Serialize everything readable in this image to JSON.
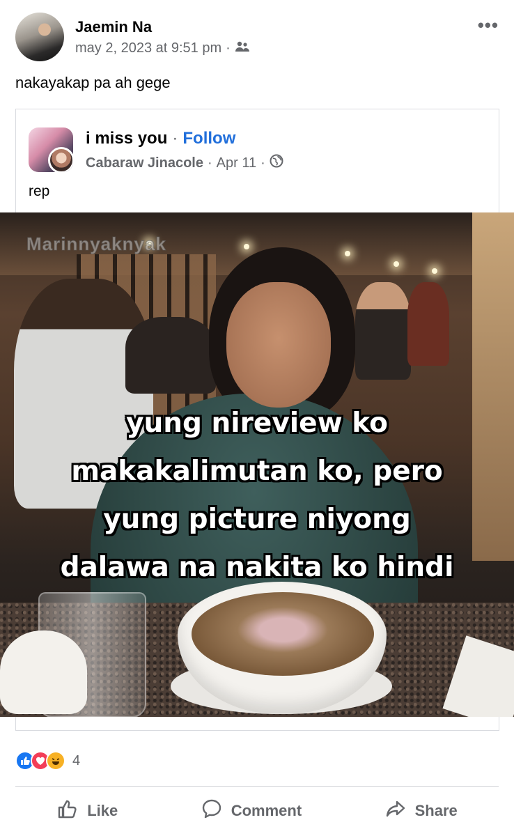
{
  "post": {
    "author": "Jaemin Na",
    "timestamp": "may 2, 2023 at 9:51 pm",
    "separator": "·",
    "audience_icon": "friends-icon",
    "more_label": "•••",
    "caption": "nakayakap pa ah gege"
  },
  "shared": {
    "group_name": "i miss you",
    "separator": "·",
    "follow_label": "Follow",
    "author": "Cabaraw Jinacole",
    "date": "Apr 11",
    "audience_icon": "globe-icon",
    "caption": "rep",
    "image": {
      "watermark": "Marinnyaknyak",
      "meme_lines": [
        "yung nireview ko",
        "makakalimutan ko, pero",
        "yung picture niyong",
        "dalawa na nakita ko hindi"
      ]
    }
  },
  "reactions": {
    "icons": [
      "like-icon",
      "love-icon",
      "haha-icon"
    ],
    "count": "4"
  },
  "actions": {
    "like": "Like",
    "comment": "Comment",
    "share": "Share"
  },
  "colors": {
    "accent": "#216fdb",
    "meta_gray": "#65676b",
    "like_blue": "#1877f2",
    "love_red": "#f33e58",
    "haha_yellow": "#f7b125"
  }
}
